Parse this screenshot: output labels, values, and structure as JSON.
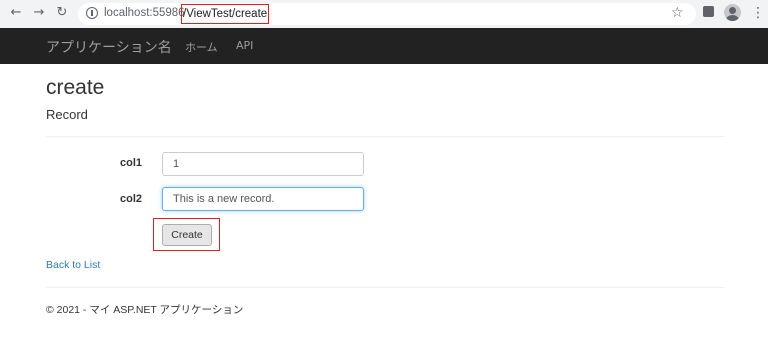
{
  "browser": {
    "url_host": "localhost:55986",
    "url_path": "/ViewTest/create"
  },
  "navbar": {
    "brand": "アプリケーション名",
    "links": [
      "ホーム",
      "API"
    ]
  },
  "page": {
    "title": "create",
    "subtitle": "Record"
  },
  "form": {
    "col1_label": "col1",
    "col1_value": "1",
    "col2_label": "col2",
    "col2_value": "This is a new record.",
    "create_label": "Create"
  },
  "back_link": "Back to List",
  "footer": "© 2021 - マイ ASP.NET アプリケーション",
  "colors": {
    "navbar_bg": "#222222",
    "link": "#337ab7",
    "highlight": "#e0201d",
    "focus": "#66afe9"
  }
}
